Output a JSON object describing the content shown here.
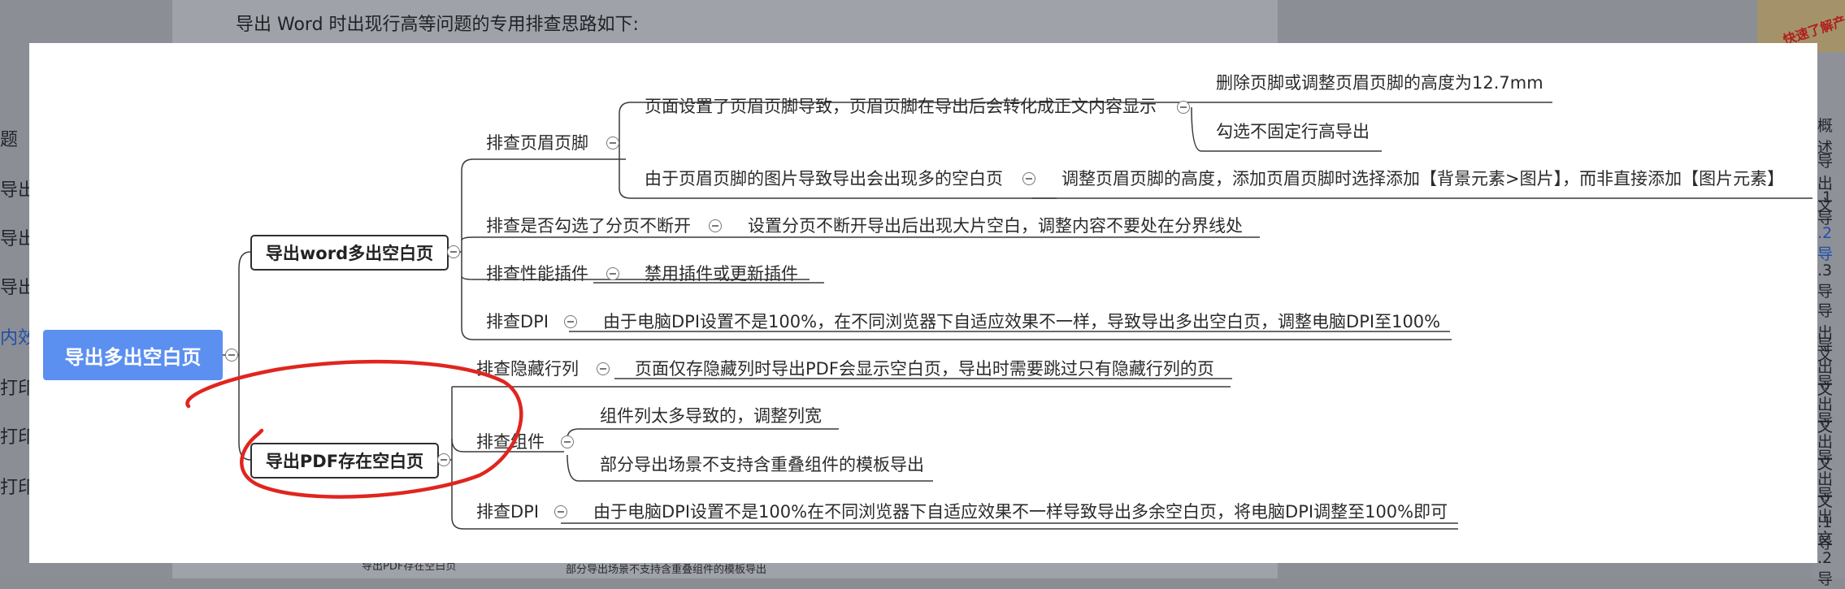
{
  "background": {
    "heading": "导出 Word 时出现行高等问题的专用排查思路如下:",
    "left_nav": [
      {
        "label": "题",
        "active": false
      },
      {
        "label": "导出",
        "active": false
      },
      {
        "label": "导出",
        "active": false
      },
      {
        "label": "导出",
        "active": false
      },
      {
        "label": "内效",
        "active": true
      },
      {
        "label": "打印",
        "active": false
      },
      {
        "label": "打印",
        "active": false
      },
      {
        "label": "打印",
        "active": false
      }
    ],
    "right_toc": [
      {
        "label": "概述",
        "active": false
      },
      {
        "label": "导出文",
        "active": false
      },
      {
        "label": ".1 导",
        "active": false
      },
      {
        "label": ".2 导",
        "active": true
      },
      {
        "label": ".3 导",
        "active": false
      },
      {
        "label": "导出文",
        "active": false
      },
      {
        "label": "导出文",
        "active": false
      },
      {
        "label": "导出文",
        "active": false
      },
      {
        "label": "导出文",
        "active": false
      },
      {
        "label": "导出文",
        "active": false
      },
      {
        "label": "导出文",
        "active": false
      },
      {
        "label": ".1 导",
        "active": false
      },
      {
        "label": ".2 导",
        "active": false
      }
    ],
    "badge_text": "快速了解产",
    "footer_node": "导出PDF存在空白页",
    "footer_text": "部分导出场景不支持含重叠组件的模板导出"
  },
  "mindmap": {
    "root": "导出多出空白页",
    "word_branch": {
      "label": "导出word多出空白页",
      "header_footer": {
        "label": "排查页眉页脚",
        "item1": {
          "label": "页面设置了页眉页脚导致，页眉页脚在导出后会转化成正文内容显示",
          "solutions": [
            "删除页脚或调整页眉页脚的高度为12.7mm",
            "勾选不固定行高导出"
          ]
        },
        "item2": {
          "label": "由于页眉页脚的图片导致导出会出现多的空白页",
          "solution": "调整页眉页脚的高度，添加页眉页脚时选择添加【背景元素>图片】，而非直接添加【图片元素】"
        }
      },
      "page_break": {
        "label": "排查是否勾选了分页不断开",
        "solution": "设置分页不断开导出后出现大片空白，调整内容不要处在分界线处"
      },
      "plugin": {
        "label": "排查性能插件",
        "solution": "禁用插件或更新插件"
      },
      "dpi": {
        "label": "排查DPI",
        "solution": "由于电脑DPI设置不是100%，在不同浏览器下自适应效果不一样，导致导出多出空白页，调整电脑DPI至100%"
      }
    },
    "pdf_branch": {
      "label": "导出PDF存在空白页",
      "hidden": {
        "label": "排查隐藏行列",
        "solution": "页面仅存隐藏列时导出PDF会显示空白页，导出时需要跳过只有隐藏行列的页"
      },
      "component": {
        "label": "排查组件",
        "solutions": [
          "组件列太多导致的，调整列宽",
          "部分导出场景不支持含重叠组件的模板导出"
        ]
      },
      "dpi": {
        "label": "排查DPI",
        "solution": "由于电脑DPI设置不是100%在不同浏览器下自适应效果不一样导致导出多余空白页，将电脑DPI调整至100%即可"
      }
    }
  },
  "colors": {
    "root_fill": "#5b8ff0",
    "annotation": "#e0251f",
    "line": "#3a3a3a",
    "active_link": "#1f4fa8"
  }
}
